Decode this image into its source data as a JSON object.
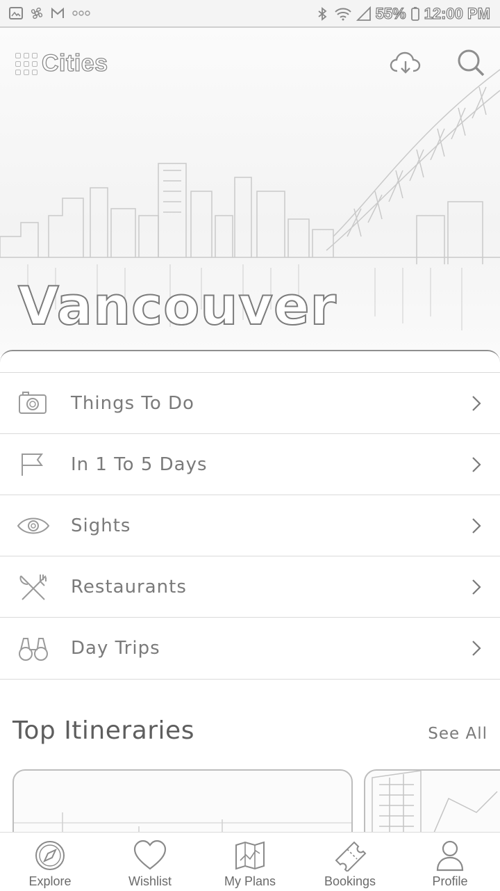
{
  "status_bar": {
    "battery": "55%",
    "time": "12:00 PM",
    "icons": [
      "gallery-icon",
      "fan-icon",
      "gmail-icon",
      "more-dots-icon",
      "bluetooth-icon",
      "wifi-icon",
      "signal-icon",
      "battery-icon"
    ]
  },
  "header": {
    "app_name": "Cities",
    "download_icon": "cloud-download-icon",
    "search_icon": "search-icon"
  },
  "hero": {
    "city": "Vancouver"
  },
  "menu": {
    "items": [
      {
        "label": "Things To Do",
        "icon": "camera-icon"
      },
      {
        "label": "In 1 To 5 Days",
        "icon": "flag-icon"
      },
      {
        "label": "Sights",
        "icon": "eye-icon"
      },
      {
        "label": "Restaurants",
        "icon": "fork-knife-icon"
      },
      {
        "label": "Day Trips",
        "icon": "binoculars-icon"
      }
    ]
  },
  "itineraries": {
    "title": "Top Itineraries",
    "see_all": "See All"
  },
  "bottom_nav": {
    "items": [
      {
        "label": "Explore",
        "icon": "compass-icon"
      },
      {
        "label": "Wishlist",
        "icon": "heart-icon"
      },
      {
        "label": "My Plans",
        "icon": "map-icon"
      },
      {
        "label": "Bookings",
        "icon": "ticket-icon"
      },
      {
        "label": "Profile",
        "icon": "person-icon"
      }
    ]
  }
}
